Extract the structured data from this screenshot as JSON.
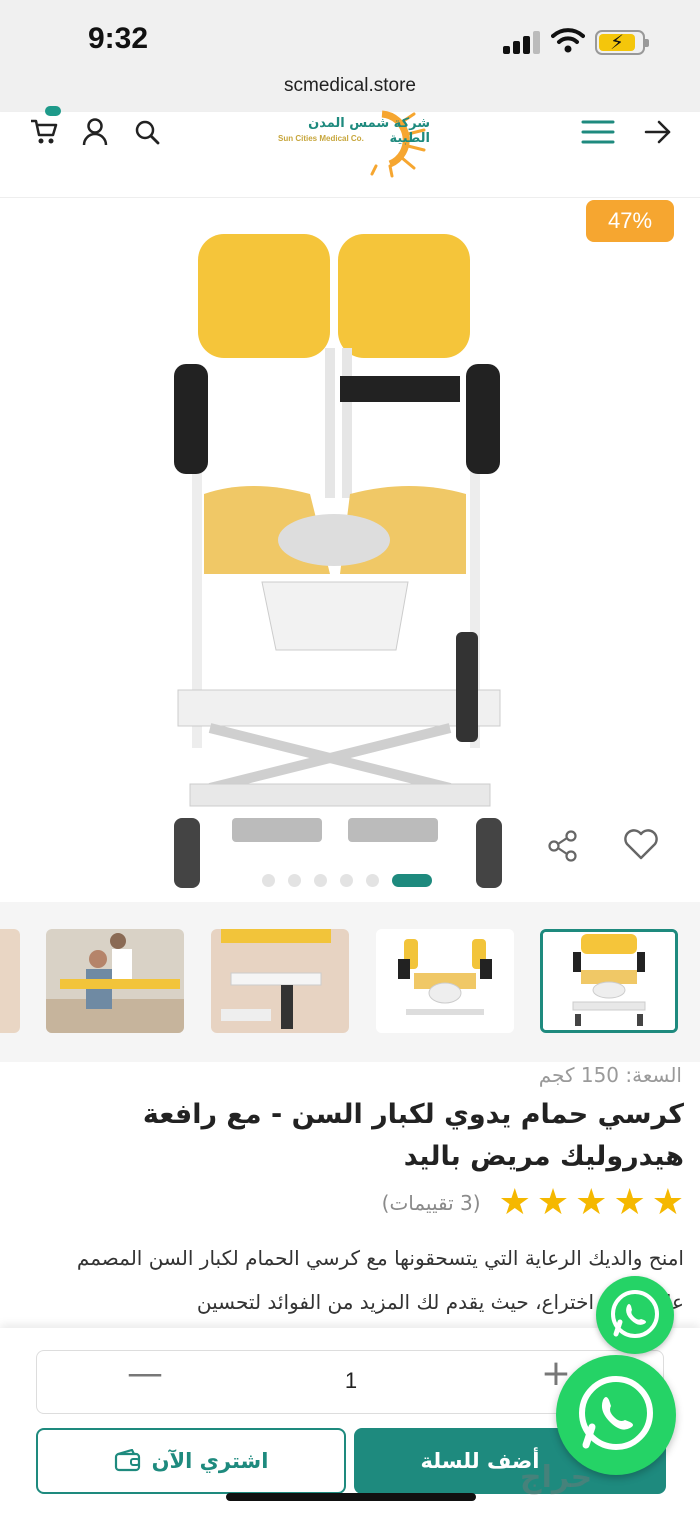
{
  "status_bar": {
    "time": "9:32"
  },
  "browser": {
    "url": "scmedical.store"
  },
  "store_header": {
    "logo_arabic": "شركة شمس المدن الطبية",
    "logo_english": "Sun Cities Medical Co."
  },
  "gallery": {
    "discount_badge": "47%",
    "dot_count": 6,
    "active_dot": 6
  },
  "product": {
    "capacity": "السعة: 150 كجم",
    "title": "كرسي حمام يدوي لكبار السن - مع رافعة هيدروليك مريض باليد",
    "rating_stars": 5,
    "rating_count": "(3 تقييمات)",
    "description": "امنح والديك الرعاية التي يتسحقونها مع كرسي الحمام لكبار السن المصمم على براءة اختراع، حيث يقدم لك المزيد من الفوائد لتحسين"
  },
  "cart": {
    "quantity": "1",
    "buy_now_label": "اشتري الآن",
    "add_to_cart_label": "أضف للسلة"
  },
  "watermark": "حراج",
  "colors": {
    "accent": "#1e8a7e",
    "discount": "#f6a630",
    "star": "#f5b800",
    "whatsapp": "#25d366"
  }
}
